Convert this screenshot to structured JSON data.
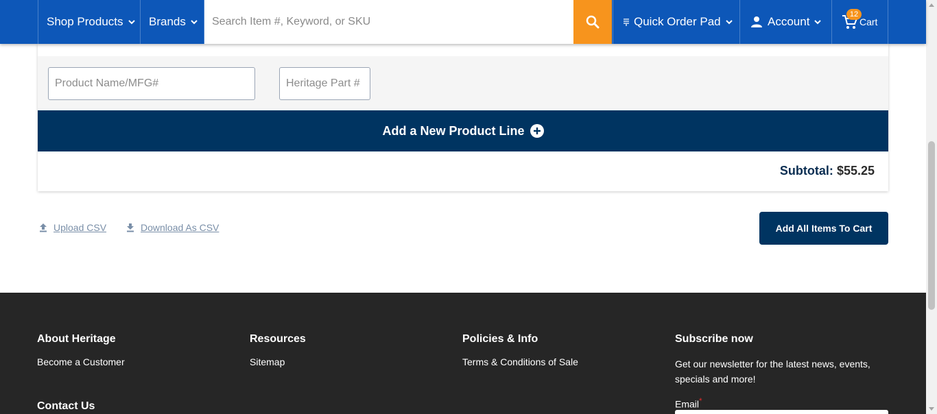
{
  "nav": {
    "shop_products": "Shop Products",
    "brands": "Brands",
    "search_placeholder": "Search Item #, Keyword, or SKU",
    "quick_order_pad": "Quick Order Pad",
    "account": "Account",
    "cart": "Cart",
    "cart_count": "12"
  },
  "form": {
    "product_name_placeholder": "Product Name/MFG#",
    "heritage_part_placeholder": "Heritage Part #",
    "add_line_label": "Add a New Product Line",
    "subtotal_label": "Subtotal:",
    "subtotal_value": "$55.25"
  },
  "actions": {
    "upload_csv": "Upload CSV",
    "download_csv": "Download As CSV",
    "add_all_to_cart": "Add All Items To Cart"
  },
  "footer": {
    "about": {
      "heading": "About Heritage",
      "links": [
        "Become a Customer"
      ]
    },
    "resources": {
      "heading": "Resources",
      "links": [
        "Sitemap"
      ]
    },
    "policies": {
      "heading": "Policies & Info",
      "links": [
        "Terms & Conditions of Sale"
      ]
    },
    "subscribe": {
      "heading": "Subscribe now",
      "text": "Get our newsletter for the latest news, events, specials and more!",
      "email_label": "Email",
      "required_mark": "*"
    },
    "contact_heading": "Contact Us"
  },
  "icons": {
    "search": "search-icon",
    "quick_order": "list-icon",
    "account": "person-icon",
    "cart": "cart-icon",
    "upload": "upload-icon",
    "download": "download-icon",
    "add": "plus-circle-icon"
  },
  "colors": {
    "nav_blue": "#0d57b8",
    "accent_orange": "#f7941d",
    "dark_navy": "#003461",
    "footer_bg": "#262626"
  }
}
